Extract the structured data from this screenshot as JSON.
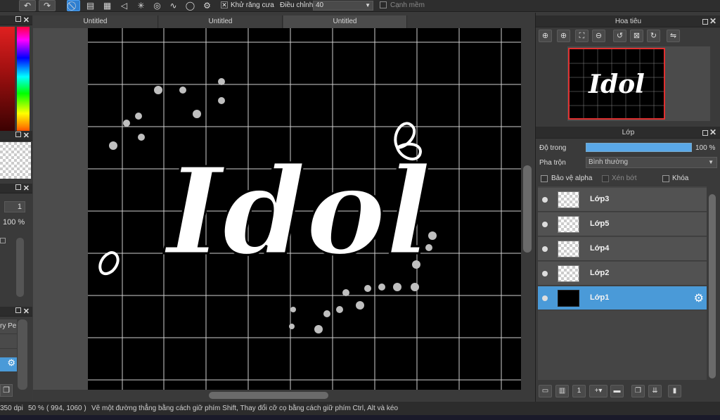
{
  "toolbar": {
    "antialias_label": "Khử răng cưa",
    "antialias_checked": true,
    "correction_label": "Điều chỉnh",
    "correction_value": "40",
    "edge_label": "Cạnh mềm",
    "edge_checked": false
  },
  "left_panel": {
    "brush_size": "1",
    "opacity": "100 %",
    "brush_partial": "ry Pe"
  },
  "tabs": [
    {
      "label": "Untitled",
      "active": false
    },
    {
      "label": "Untitled",
      "active": false
    },
    {
      "label": "Untitled",
      "active": true
    }
  ],
  "canvas": {
    "artwork_text": "Idol"
  },
  "navigator": {
    "title": "Hoa tiêu"
  },
  "layers_panel": {
    "title": "Lớp",
    "opacity_label": "Độ trong",
    "opacity_value": "100 %",
    "opacity_fraction": 1.0,
    "blend_label": "Pha trộn",
    "blend_value": "Bình thường",
    "protect_alpha_label": "Bảo vệ alpha",
    "clipping_label": "Xén bớt",
    "lock_label": "Khóa",
    "layers": [
      {
        "name": "Lớp3",
        "selected": false
      },
      {
        "name": "Lớp5",
        "selected": false
      },
      {
        "name": "Lớp4",
        "selected": false
      },
      {
        "name": "Lớp2",
        "selected": false
      },
      {
        "name": "Lớp1",
        "selected": true
      }
    ]
  },
  "status": {
    "dpi": "350 dpi",
    "zoom": "50 %",
    "coords": "( 994, 1060 )",
    "hint": "Vẽ một đường thẳng bằng cách giữ phím Shift, Thay đổi cỡ cọ bằng cách giữ phím Ctrl, Alt và kéo"
  },
  "colors": {
    "accent": "#4a9ad8",
    "canvas_bg": "#000000",
    "panel_bg": "#3a3a3a"
  }
}
